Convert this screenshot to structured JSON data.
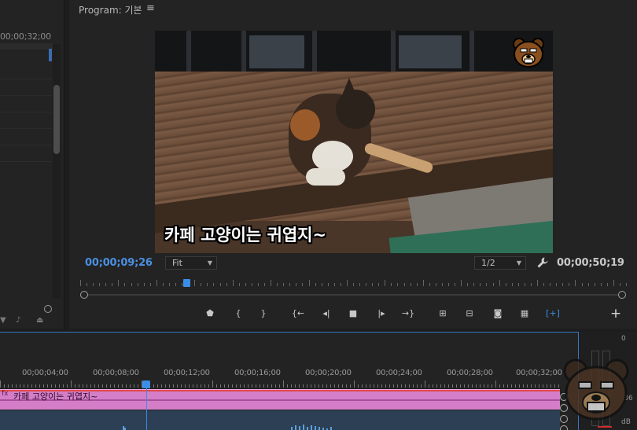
{
  "source_panel": {
    "timecode": "00;00;32;00"
  },
  "program_monitor": {
    "title": "Program: 기본",
    "menu_icon": "hamburger-menu-icon",
    "subtitle_text": "카페 고양이는 귀엽지~",
    "current_timecode": "00;00;09;26",
    "duration_timecode": "00;00;50;19",
    "fit_option": "Fit",
    "resolution_option": "1/2",
    "settings_icon": "wrench-icon",
    "playback_position": 0.194,
    "transport_icons": [
      "add-marker-icon",
      "mark-in-icon",
      "mark-out-icon",
      "go-to-in-icon",
      "step-back-icon",
      "stop-icon",
      "step-forward-icon",
      "go-to-out-icon",
      "lift-icon",
      "extract-icon",
      "export-frame-icon",
      "comparison-view-icon",
      "safe-margins-icon"
    ],
    "add_button_icon": "plus-icon"
  },
  "timeline": {
    "ruler_labels": [
      "00;00;04;00",
      "00;00;08;00",
      "00;00;12;00",
      "00;00;16;00",
      "00;00;20;00",
      "00;00;24;00",
      "00;00;28;00",
      "00;00;32;00"
    ],
    "clip_fx_badge": "fx",
    "clip_label": "카페 고양이는 귀엽지~"
  },
  "audio_meter": {
    "top_label": "0",
    "mid_label": "-36",
    "unit_label": "dB"
  },
  "colors": {
    "accent_blue": "#3a8ee6",
    "timecode_blue": "#4a90e2",
    "clip_pink": "#d47ec8",
    "audio_track": "#2c3f55"
  }
}
